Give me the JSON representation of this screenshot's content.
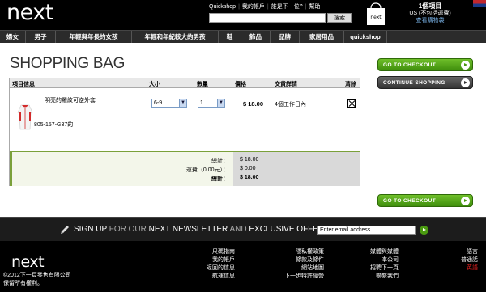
{
  "header": {
    "logo": "next",
    "top_links": [
      "Quickshop",
      "我的帳戶",
      "誰是下一位?",
      "幫助"
    ],
    "search_button": "搜索",
    "bag_count": "1個項目",
    "bag_total": "US (不包括運費)",
    "bag_link": "查看購物袋"
  },
  "nav": {
    "items": [
      "婦女",
      "男子",
      "年輕與年長的女孩",
      "年輕和年紀較大的男孩",
      "鞋",
      "飾品",
      "品牌",
      "家居用品",
      "quickshop"
    ]
  },
  "main": {
    "title": "SHOPPING BAG",
    "columns": {
      "item_info": "項目信息",
      "size": "大小",
      "quantity": "數量",
      "price": "價格",
      "delivery": "交貨詳情",
      "remove": "清除"
    },
    "item": {
      "name": "明亮的羅紋可逆外套",
      "sku": "805-157-G37的",
      "size": "6-9",
      "quantity": "1",
      "price": "$ 18.00",
      "delivery": "4個工作日內",
      "remove_checked": true
    },
    "totals": {
      "subtotal_label": "總計：",
      "shipping_label": "運費（0.00元）：",
      "total_label": "總計：",
      "subtotal": "$ 18.00",
      "shipping": "$ 0.00",
      "total": "$ 18.00"
    },
    "buttons": {
      "checkout": "GO TO CHECKOUT",
      "continue": "CONTINUE SHOPPING"
    }
  },
  "newsletter": {
    "signup": "SIGN UP",
    "for_our": "FOR OUR",
    "next": "NEXT",
    "newsletter": "NEWSLETTER",
    "and": "AND",
    "exclusive": "EXCLUSIVE OFFERS",
    "placeholder": "Enter email address"
  },
  "footer": {
    "logo": "next",
    "copyright": "©2012下一頁零售有限公司保留所有權利。",
    "col1": [
      "尺碼指南",
      "我的帳戶",
      "返回的信息",
      "航運信息"
    ],
    "col2": [
      "隱私權政策",
      "條款及條件",
      "網站地圖",
      "下一步特許經營"
    ],
    "col3": [
      "媒體與媒體",
      "本公司",
      "招聘下一頁",
      "聯繫我們"
    ],
    "col4": [
      "語言",
      "普通話",
      "英語"
    ]
  },
  "colors": {
    "accent_green": "#4a9a10",
    "link_blue": "#7ab3e8",
    "active_language": "#e02020"
  }
}
